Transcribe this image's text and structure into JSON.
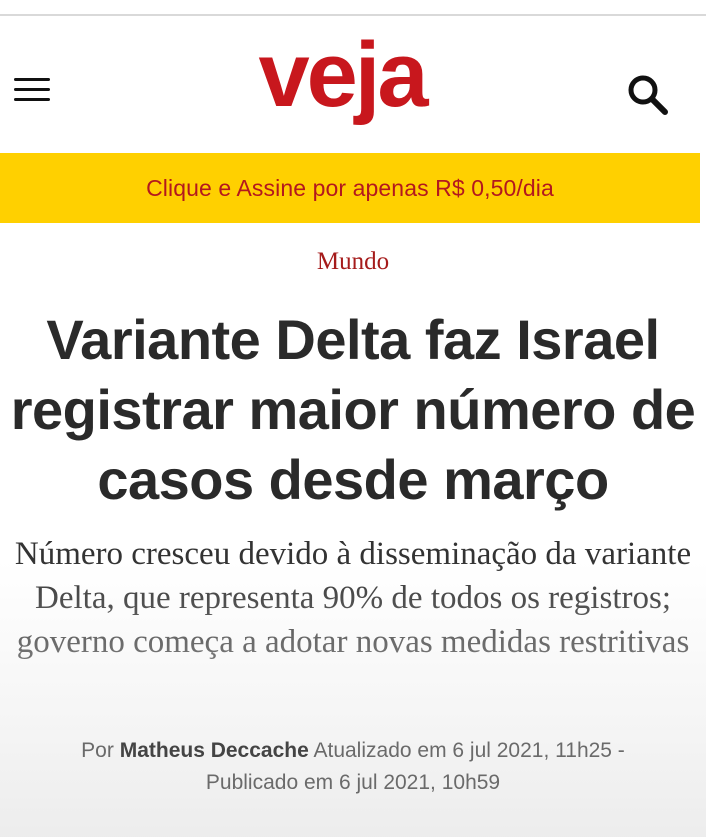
{
  "header": {
    "logo_text": "veja",
    "menu_icon": "hamburger-menu-icon",
    "search_icon": "search-icon",
    "brand_color": "#c8171d"
  },
  "promo": {
    "text": "Clique e Assine por apenas R$ 0,50/dia",
    "background": "#ffd000",
    "text_color": "#b3181e"
  },
  "article": {
    "section": "Mundo",
    "headline": "Variante Delta faz Israel registrar maior número de casos desde março",
    "subtitle": "Número cresceu devido à disseminação da variante Delta, que representa 90% de todos os registros; governo começa a adotar novas medidas restritivas",
    "byline": {
      "prefix": "Por",
      "author": "Matheus Deccache",
      "updated": "Atualizado em 6 jul 2021, 11h25 -",
      "published": "Publicado em 6 jul 2021, 10h59"
    }
  }
}
